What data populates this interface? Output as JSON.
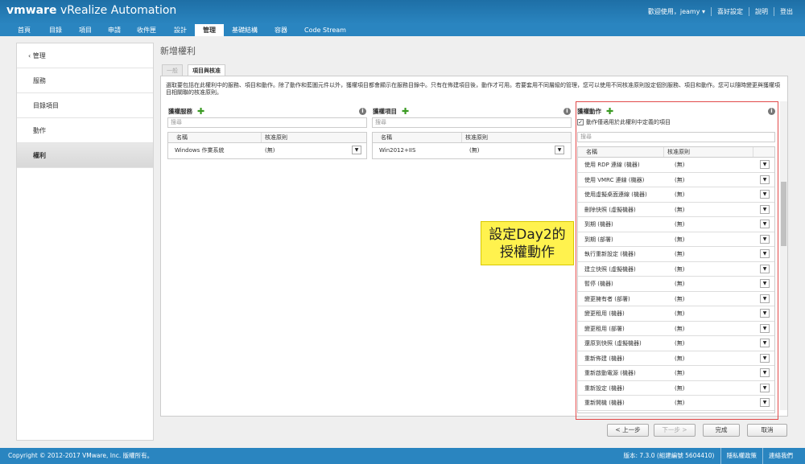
{
  "header": {
    "logo_brand": "vmware",
    "logo_product": " vRealize",
    "logo_suffix": " Automation",
    "links": [
      "歡迎使用，jeamy ▾",
      "喜好設定",
      "說明",
      "登出"
    ]
  },
  "nav": {
    "tabs": [
      {
        "label": "首頁"
      },
      {
        "label": "目錄"
      },
      {
        "label": "項目"
      },
      {
        "label": "申請"
      },
      {
        "label": "收件匣"
      },
      {
        "label": "設計"
      },
      {
        "label": "管理"
      },
      {
        "label": "基礎結構"
      },
      {
        "label": "容器"
      },
      {
        "label": "Code Stream"
      }
    ],
    "active": "管理"
  },
  "sidebar": {
    "back_label": "管理",
    "items": [
      {
        "label": "服務"
      },
      {
        "label": "目錄項目"
      },
      {
        "label": "動作"
      },
      {
        "label": "權利"
      }
    ],
    "active": "權利"
  },
  "page": {
    "title": "新增權利",
    "tabs": [
      {
        "label": "一般"
      },
      {
        "label": "項目與核准"
      }
    ],
    "description": "選取要包括在此權利中的服務、項目和動作。除了動作和藍圖元件以外，獲權項目都會顯示在服務目錄中。只有在佈建項目後，動作才可用。若要套用不同層級的管理，您可以使用不同核准原則設定個別服務、項目和動作。您可以隨時變更與獲權項目相關聯的核准原則。"
  },
  "services": {
    "title": "獲權服務",
    "search_placeholder": "搜尋",
    "col_name": "名稱",
    "col_policy": "核准原則",
    "rows": [
      {
        "name": "Windows 作業系統",
        "policy": "(無)"
      }
    ]
  },
  "items": {
    "title": "獲權項目",
    "search_placeholder": "搜尋",
    "col_name": "名稱",
    "col_policy": "核准原則",
    "rows": [
      {
        "name": "Win2012+IIS",
        "policy": "(無)"
      }
    ]
  },
  "actions": {
    "title": "獲權動作",
    "checkbox_label": "動作僅適用於此權利中定義的項目",
    "search_placeholder": "搜尋",
    "col_name": "名稱",
    "col_policy": "核准原則",
    "rows": [
      {
        "name": "使用 RDP 連線 (機器)",
        "policy": "(無)"
      },
      {
        "name": "使用 VMRC 連線 (機器)",
        "policy": "(無)"
      },
      {
        "name": "使用虛擬桌面連線 (機器)",
        "policy": "(無)"
      },
      {
        "name": "刪除快照 (虛擬機器)",
        "policy": "(無)"
      },
      {
        "name": "到期 (機器)",
        "policy": "(無)"
      },
      {
        "name": "到期 (部署)",
        "policy": "(無)"
      },
      {
        "name": "執行重新設定 (機器)",
        "policy": "(無)"
      },
      {
        "name": "建立快照 (虛擬機器)",
        "policy": "(無)"
      },
      {
        "name": "暫停 (機器)",
        "policy": "(無)"
      },
      {
        "name": "變更擁有者 (部署)",
        "policy": "(無)"
      },
      {
        "name": "變更租用 (機器)",
        "policy": "(無)"
      },
      {
        "name": "變更租用 (部署)",
        "policy": "(無)"
      },
      {
        "name": "還原到快照 (虛擬機器)",
        "policy": "(無)"
      },
      {
        "name": "重新佈建 (機器)",
        "policy": "(無)"
      },
      {
        "name": "重新啟動電源 (機器)",
        "policy": "(無)"
      },
      {
        "name": "重新設定 (機器)",
        "policy": "(無)"
      },
      {
        "name": "重新開機 (機器)",
        "policy": "(無)"
      }
    ]
  },
  "callout": {
    "line1": "設定Day2的",
    "line2": "授權動作"
  },
  "buttons": {
    "prev": "< 上一步",
    "next": "下一步 >",
    "finish": "完成",
    "cancel": "取消"
  },
  "footer": {
    "copyright": "Copyright © 2012-2017 VMware, Inc. 版權所有。",
    "version": "版本: 7.3.0 (組建編號 5604410)",
    "privacy": "隱私權政策",
    "contact": "連絡我們"
  },
  "colors": {
    "header_blue": "#2a85c0",
    "highlight_red": "#e24a4a",
    "callout_yellow": "#fff24e",
    "plus_green": "#3a9a22"
  }
}
